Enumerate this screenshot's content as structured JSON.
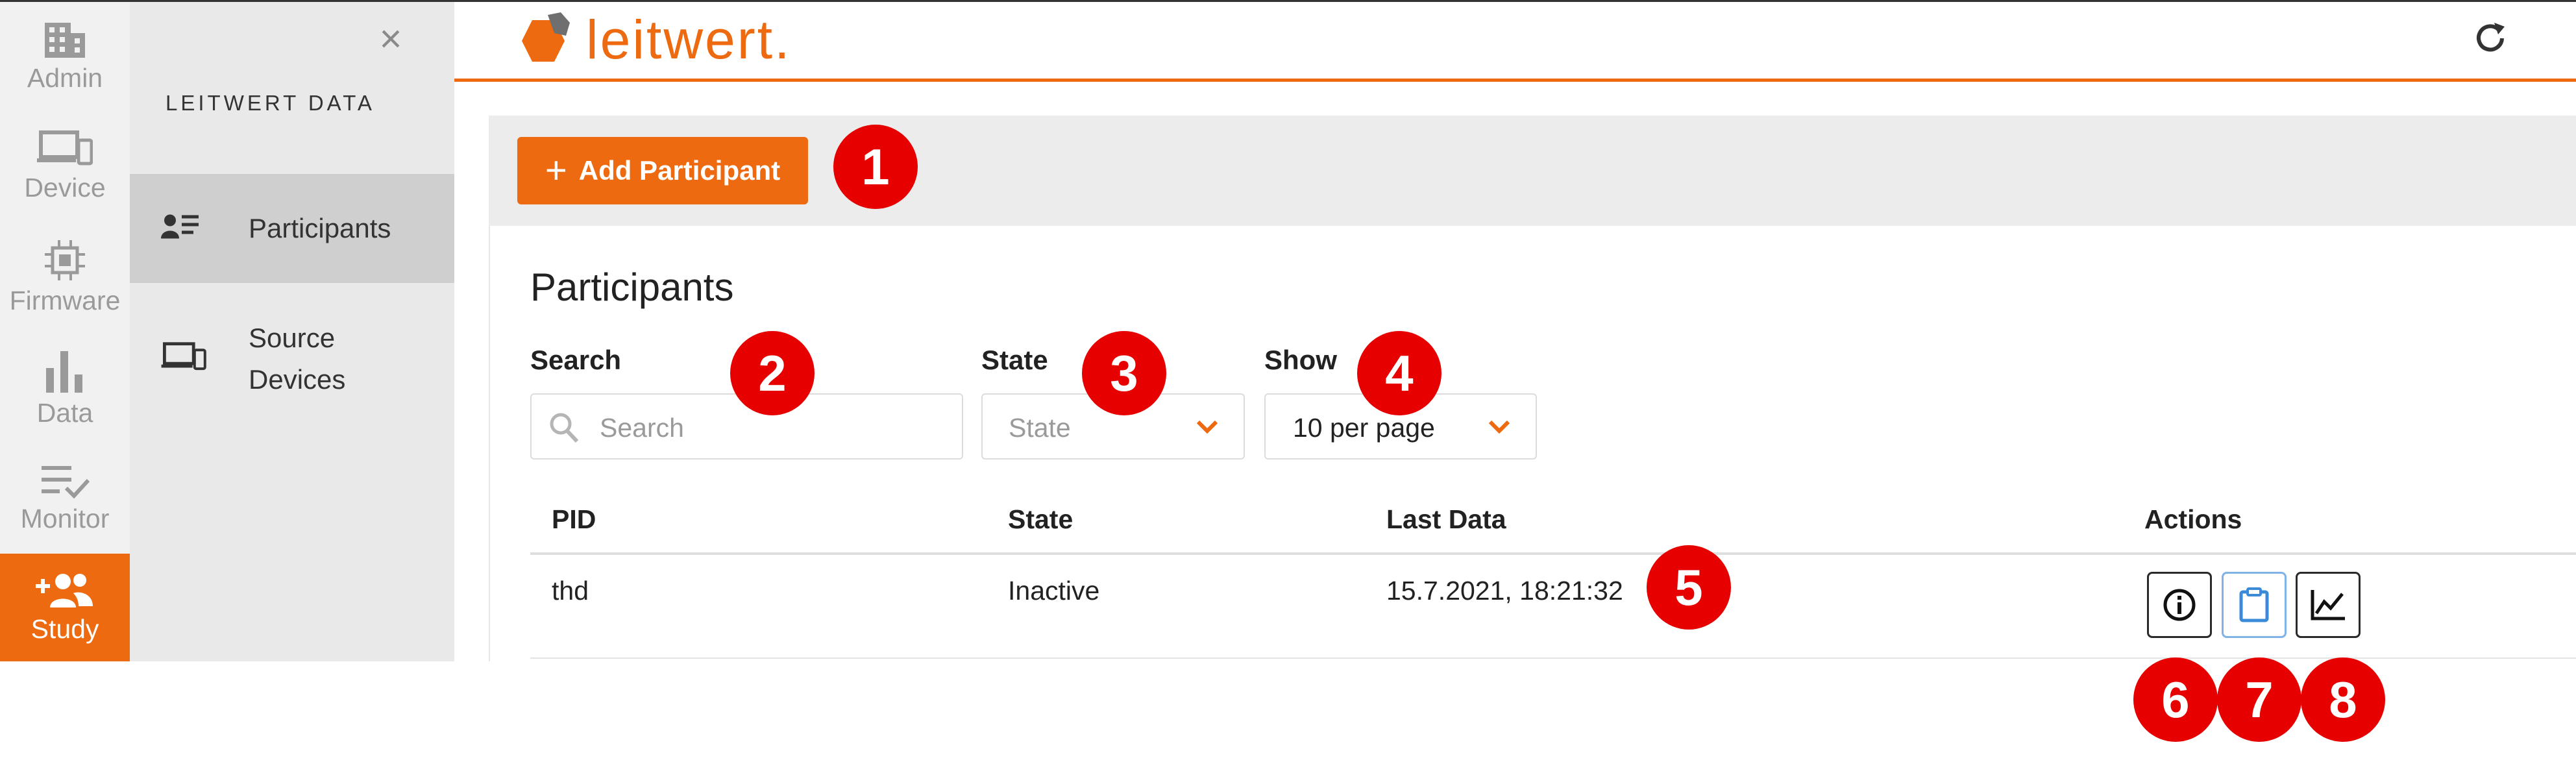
{
  "rail": {
    "items": [
      {
        "label": "Admin",
        "icon": "building-icon"
      },
      {
        "label": "Device",
        "icon": "devices-icon"
      },
      {
        "label": "Firmware",
        "icon": "chip-icon"
      },
      {
        "label": "Data",
        "icon": "bar-chart-icon"
      },
      {
        "label": "Monitor",
        "icon": "checklist-icon"
      },
      {
        "label": "Study",
        "icon": "people-add-icon",
        "active": true
      }
    ]
  },
  "menu": {
    "title": "LEITWERT DATA",
    "items": [
      {
        "label": "Participants",
        "icon": "participant-list-icon",
        "selected": true
      },
      {
        "label_line1": "Source",
        "label_line2": "Devices",
        "icon": "devices-icon"
      }
    ]
  },
  "header": {
    "logo_text": "leitwert."
  },
  "toolbar": {
    "add_label": "Add Participant"
  },
  "page": {
    "heading": "Participants",
    "search_label": "Search",
    "search_placeholder": "Search",
    "state_label": "State",
    "state_placeholder": "State",
    "show_label": "Show",
    "show_value": "10 per page"
  },
  "table": {
    "columns": [
      "PID",
      "State",
      "Last Data",
      "Actions"
    ],
    "rows": [
      {
        "pid": "thd",
        "state": "Inactive",
        "last_data": "15.7.2021, 18:21:32"
      }
    ],
    "actions": [
      "info-icon",
      "clipboard-icon",
      "line-chart-icon"
    ]
  },
  "callouts": [
    "1",
    "2",
    "3",
    "4",
    "5",
    "6",
    "7",
    "8"
  ],
  "colors": {
    "accent": "#ee6a10",
    "callout": "#e60000",
    "rail_bg": "#f1f1f1",
    "menu_bg": "#e9e9e9"
  }
}
